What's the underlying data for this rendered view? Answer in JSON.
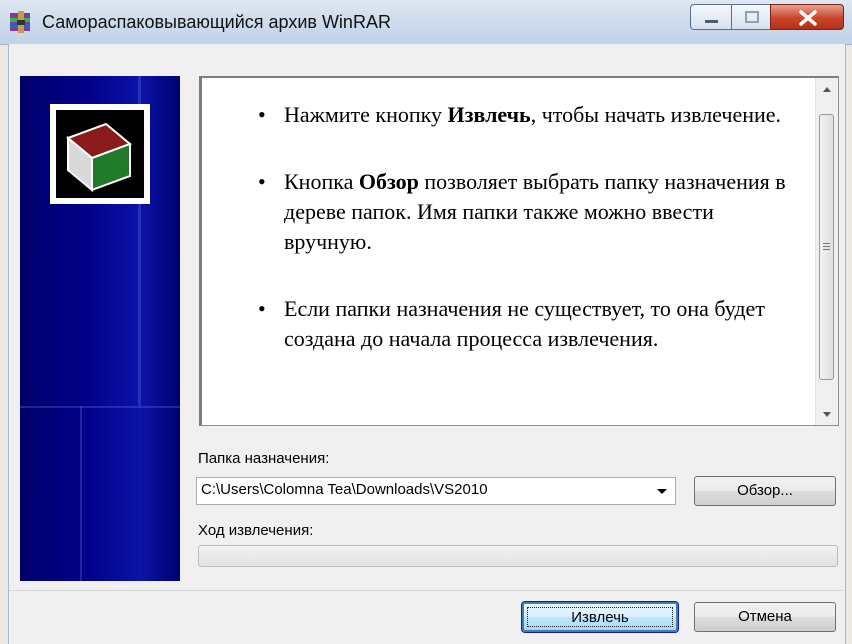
{
  "window": {
    "title": "Самораспаковывающийся архив WinRAR",
    "controls": {
      "minimize_icon": "minimize-icon",
      "maximize_icon": "maximize-icon",
      "close_icon": "close-icon"
    }
  },
  "readme": {
    "items": [
      {
        "before": "Нажмите кнопку ",
        "bold": "Извлечь",
        "after": ", чтобы начать извлечение."
      },
      {
        "before": "Кнопка ",
        "bold": "Обзор",
        "after": " позволяет выбрать папку назначения в дереве папок. Имя папки также можно ввести вручную."
      },
      {
        "before": "Если папки назначения не существует, то она будет создана до начала процесса извлечения.",
        "bold": "",
        "after": ""
      }
    ],
    "bullet": "•"
  },
  "destination": {
    "label": "Папка назначения:",
    "value": "C:\\Users\\Colomna Tea\\Downloads\\VS2010",
    "browse_label": "Обзор..."
  },
  "progress": {
    "label": "Ход извлечения:",
    "value": 0
  },
  "buttons": {
    "extract_label": "Извлечь",
    "cancel_label": "Отмена"
  },
  "colors": {
    "sidebar": "#000088",
    "close_button": "#c9452b",
    "default_button_border": "#3c7fb1"
  }
}
